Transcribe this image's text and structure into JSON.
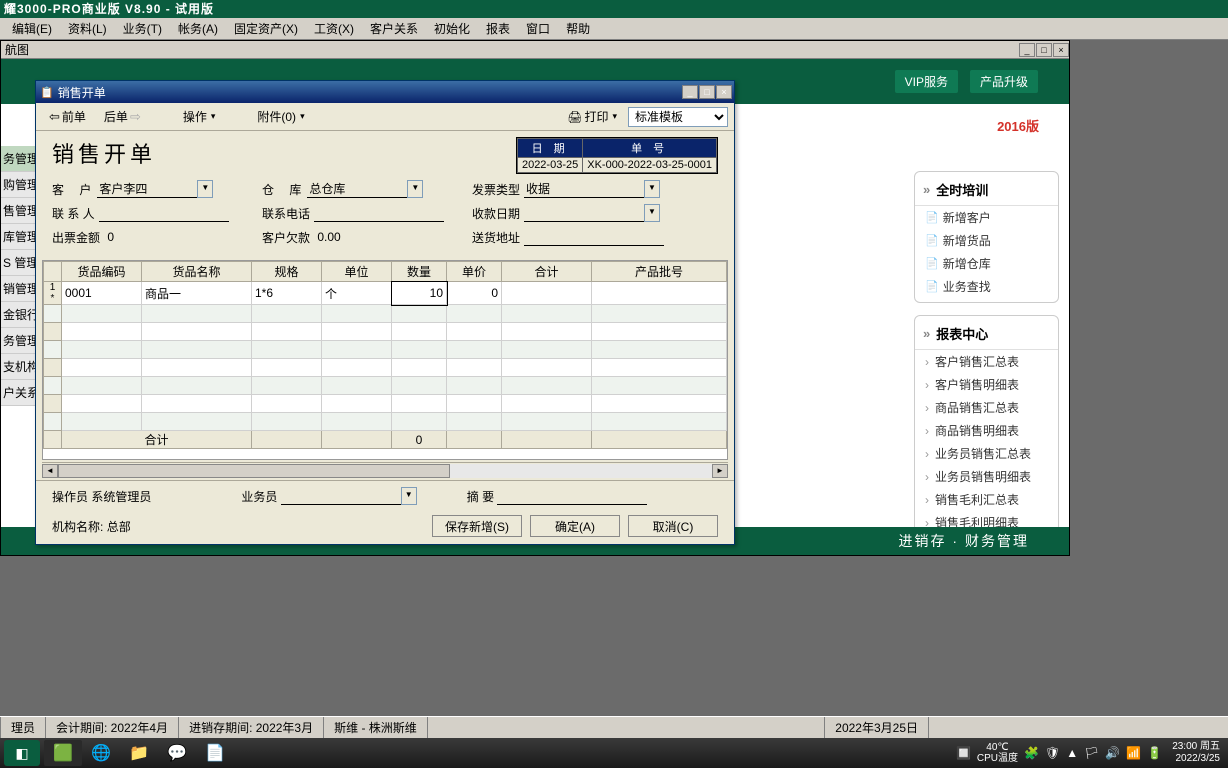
{
  "app": {
    "title": "耀3000-PRO商业版 V8.90 - 试用版"
  },
  "menu": [
    "编辑(E)",
    "资料(L)",
    "业务(T)",
    "帐务(A)",
    "固定资产(X)",
    "工资(X)",
    "客户关系",
    "初始化",
    "报表",
    "窗口",
    "帮助"
  ],
  "navWin": {
    "title": "航图",
    "header": {
      "vip": "VIP服务",
      "upgrade": "产品升级",
      "version": "2016版"
    },
    "footer": "进销存 · 财务管理",
    "leftItems": [
      "务管理",
      "购管理",
      "售管理",
      "库管理",
      "S 管理",
      "销管理",
      "金银行",
      "务管理",
      "支机构",
      "户关系"
    ]
  },
  "rightSb": {
    "p1": {
      "title": "全时培训",
      "items": [
        "新增客户",
        "新增货品",
        "新增仓库",
        "业务查找"
      ]
    },
    "p2": {
      "title": "报表中心",
      "items": [
        "客户销售汇总表",
        "客户销售明细表",
        "商品销售汇总表",
        "商品销售明细表",
        "业务员销售汇总表",
        "业务员销售明细表",
        "销售毛利汇总表",
        "销售毛利明细表"
      ]
    }
  },
  "dlg": {
    "title": "销售开单",
    "toolbar": {
      "prev": "前单",
      "next": "后单",
      "op": "操作",
      "attach": "附件(0)",
      "print": "打印",
      "template": "标准模板"
    },
    "bigTitle": "销售开单",
    "idBox": {
      "dateLabel": "日  期",
      "date": "2022-03-25",
      "noLabel": "单    号",
      "no": "XK-000-2022-03-25-0001"
    },
    "form": {
      "custLabel": "客    户",
      "cust": "客户李四",
      "whLabel": "仓    库",
      "wh": "总仓库",
      "invTypeLabel": "发票类型",
      "invType": "收据",
      "contactLabel": "联 系 人",
      "contact": "",
      "phoneLabel": "联系电话",
      "phone": "",
      "payDateLabel": "收款日期",
      "payDate": "",
      "ticketAmtLabel": "出票金额",
      "ticketAmt": "0",
      "oweLabel": "客户欠款",
      "owe": "0.00",
      "addrLabel": "送货地址",
      "addr": ""
    },
    "grid": {
      "headers": [
        "货品编码",
        "货品名称",
        "规格",
        "单位",
        "数量",
        "单价",
        "合计",
        "产品批号"
      ],
      "row1": {
        "idx": "1 *",
        "code": "0001",
        "name": "商品一",
        "spec": "1*6",
        "unit": "个",
        "qty": "10",
        "price": "0",
        "total": "",
        "batch": ""
      },
      "sumLabel": "合计",
      "sumQty": "0"
    },
    "footForm": {
      "operLabel": "操作员",
      "oper": "系统管理员",
      "salesLabel": "业务员",
      "summaryLabel": "摘    要"
    },
    "bottom": {
      "orgLabel": "机构名称:",
      "org": "总部",
      "saveNew": "保存新增(S)",
      "confirm": "确定(A)",
      "cancel": "取消(C)"
    }
  },
  "status": {
    "s1": "理员",
    "s2": "会计期间: 2022年4月",
    "s3": "进销存期间: 2022年3月",
    "s4": "斯维 - 株洲斯维",
    "s5": "2022年3月25日"
  },
  "taskbar": {
    "temp": "40℃",
    "tempLabel": "CPU温度",
    "time": "23:00",
    "date": "2022/3/25",
    "day": "周五"
  }
}
